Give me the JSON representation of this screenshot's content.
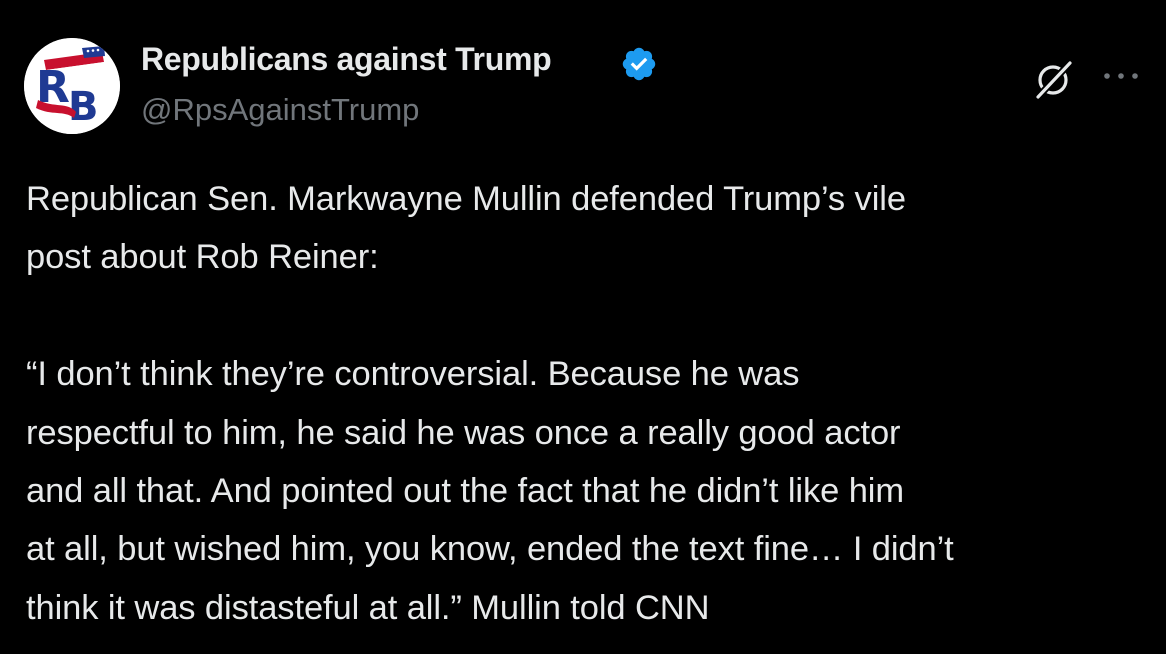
{
  "author": {
    "display_name": "Republicans against Trump",
    "handle": "@RpsAgainstTrump",
    "verified": true,
    "verified_color": "#1d9bf0",
    "avatar_letters": "RB"
  },
  "actions": {
    "grok_icon": "grok-icon",
    "more_icon": "more-options-icon"
  },
  "tweet": {
    "paragraph_1": [
      "Republican Sen. Markwayne Mullin defended Trump’s vile",
      "post about Rob Reiner:"
    ],
    "paragraph_2": [
      "“I don’t think they’re controversial. Because he was",
      "respectful to him, he said he was once a really good actor",
      "and all that. And pointed out the fact that he didn’t like him",
      "at all, but wished him, you know, ended the text fine… I didn’t",
      "think it was distasteful at all.” Mullin told CNN"
    ]
  },
  "colors": {
    "background": "#000000",
    "text": "#e7e9ea",
    "secondary": "#71767b"
  }
}
